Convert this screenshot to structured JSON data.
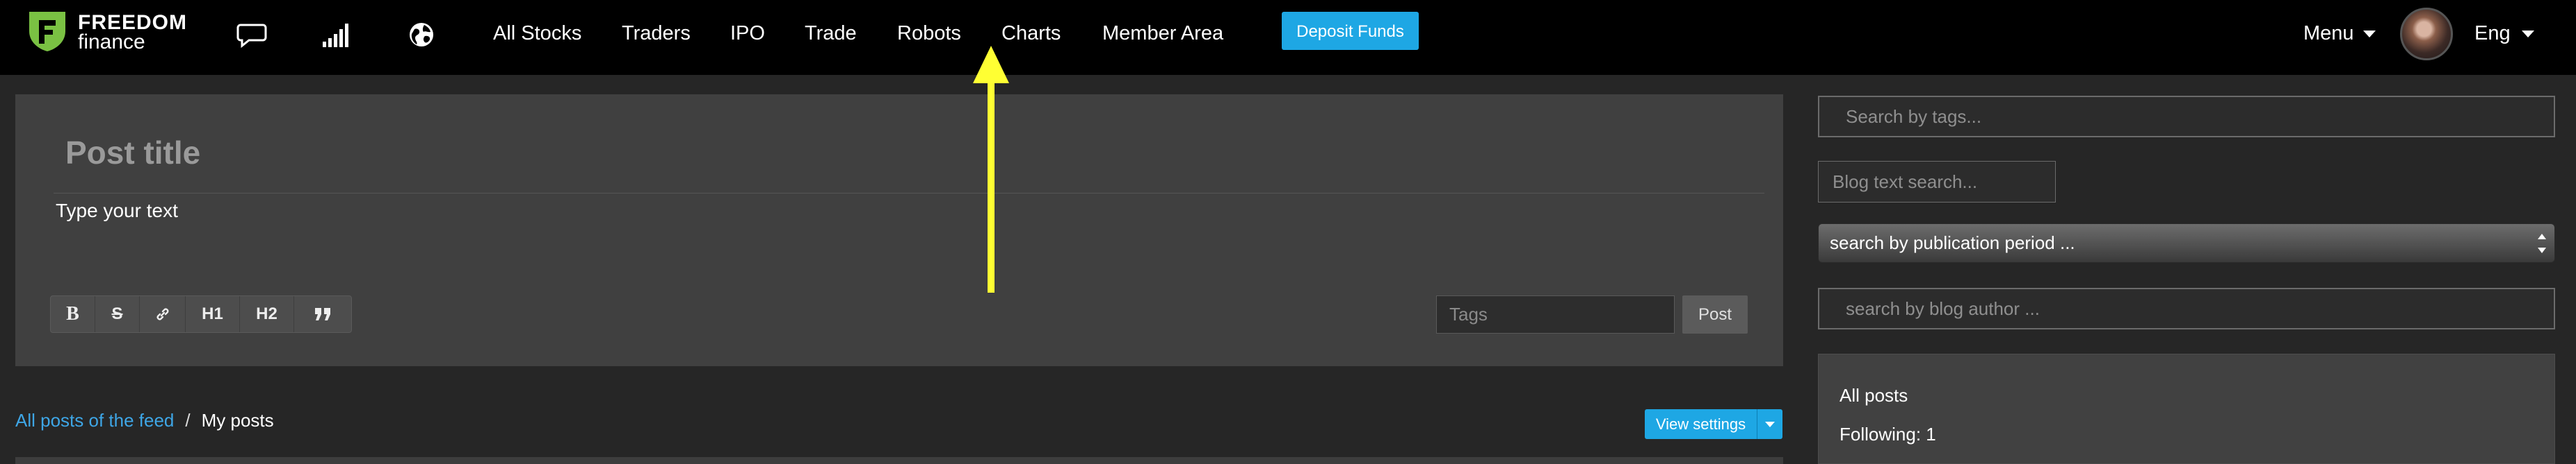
{
  "header": {
    "logo": {
      "line1": "FREEDOM",
      "line2": "finance",
      "brand_color": "#7ac143"
    },
    "icons": [
      "chat-icon",
      "signal-icon",
      "globe-icon"
    ],
    "nav": [
      "All Stocks",
      "Traders",
      "IPO",
      "Trade",
      "Robots",
      "Charts",
      "Member Area"
    ],
    "deposit_label": "Deposit Funds",
    "menu_label": "Menu",
    "lang_label": "Eng"
  },
  "editor": {
    "title_placeholder": "Post title",
    "body_placeholder": "Type your text",
    "toolbar": [
      "B",
      "S",
      "link-icon",
      "H1",
      "H2",
      "quote-icon"
    ],
    "tags_placeholder": "Tags",
    "post_label": "Post"
  },
  "feed": {
    "breadcrumb_link": "All posts of the feed",
    "breadcrumb_sep": "/",
    "breadcrumb_current": "My posts",
    "view_settings_label": "View settings"
  },
  "sidebar": {
    "tags_search_placeholder": "Search by tags...",
    "text_search_placeholder": "Blog text search...",
    "period_select_value": "search by publication period ...",
    "author_search_placeholder": "search by blog author ...",
    "filter_all": "All posts",
    "following": "Following: 1"
  },
  "colors": {
    "accent": "#1ea7e4",
    "link": "#3ea6e6",
    "annotation_arrow": "#ffff33",
    "nav_bg": "#000000"
  }
}
